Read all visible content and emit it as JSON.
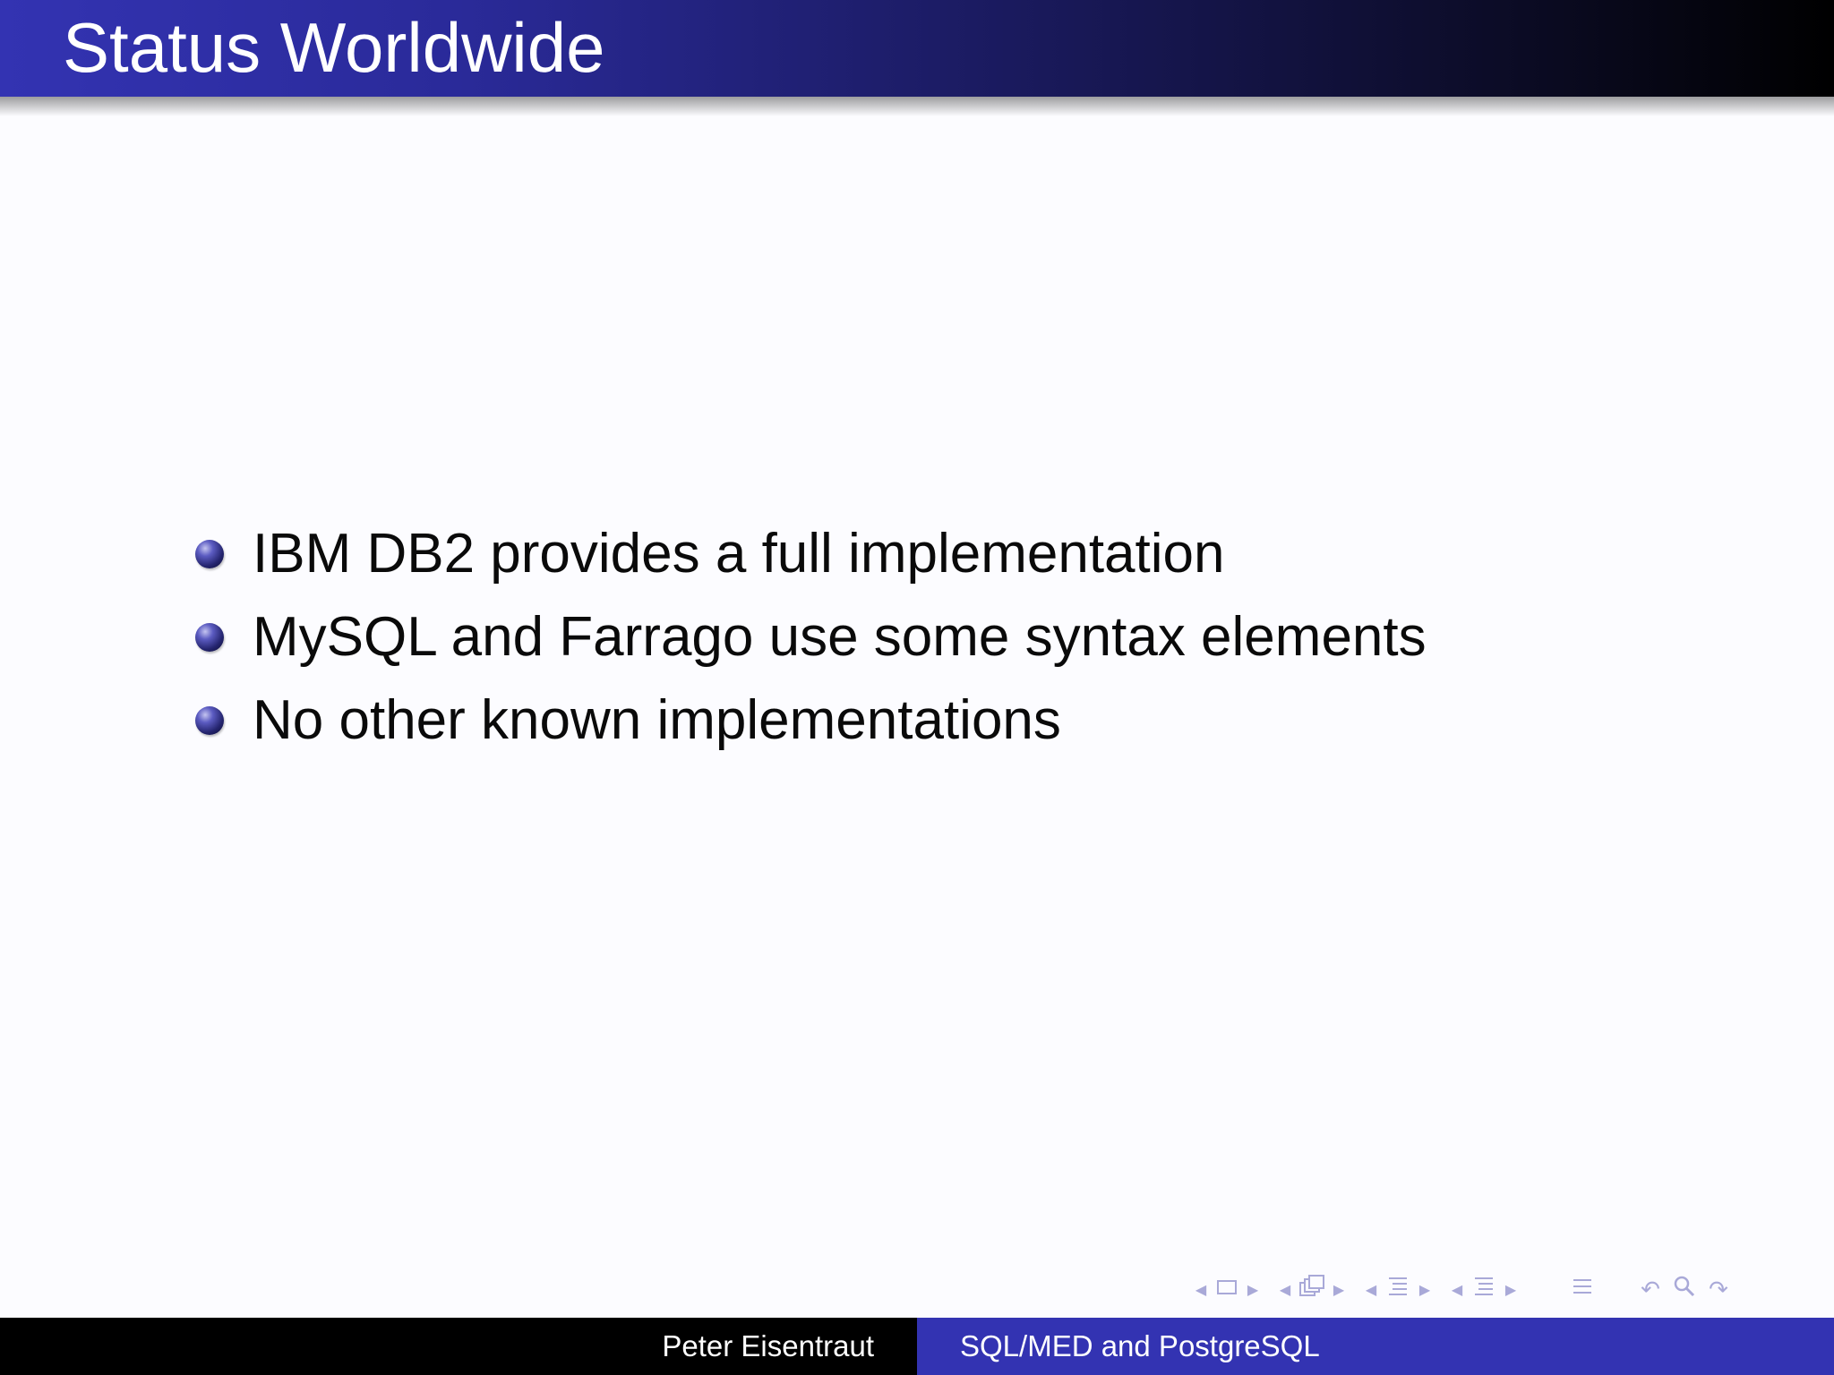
{
  "slide": {
    "title": "Status Worldwide",
    "bullets": [
      "IBM DB2 provides a full implementation",
      "MySQL and Farrago use some syntax elements",
      "No other known implementations"
    ]
  },
  "footer": {
    "author": "Peter Eisentraut",
    "talk_title": "SQL/MED and PostgreSQL"
  },
  "navigation": {
    "icons": [
      "nav-prev-icon",
      "slide-icon",
      "nav-next-icon",
      "nav-prev-icon",
      "frame-icon",
      "nav-next-icon",
      "nav-prev-icon",
      "subsection-icon",
      "nav-next-icon",
      "nav-prev-icon",
      "section-icon",
      "nav-next-icon",
      "appendix-icon",
      "undo-icon",
      "search-icon",
      "redo-icon"
    ]
  },
  "colors": {
    "title_gradient_start": "#3333b2",
    "title_gradient_end": "#000000",
    "footer_left_bg": "#000000",
    "footer_right_bg": "#3333b2",
    "bullet": "#2a2a80",
    "nav_icons": "#a9a9d8"
  }
}
